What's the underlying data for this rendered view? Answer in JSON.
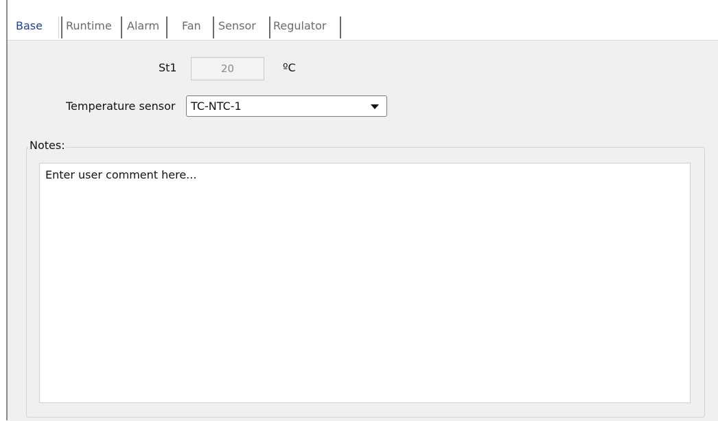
{
  "tabs": [
    {
      "label": "Base",
      "active": true
    },
    {
      "label": "Runtime",
      "active": false
    },
    {
      "label": "Alarm",
      "active": false
    },
    {
      "label": "Fan",
      "active": false
    },
    {
      "label": "Sensor",
      "active": false
    },
    {
      "label": "Regulator",
      "active": false
    }
  ],
  "form": {
    "st1_label": "St1",
    "st1_value": "20",
    "st1_unit": "ºC",
    "temp_sensor_label": "Temperature sensor",
    "temp_sensor_value": "TC-NTC-1"
  },
  "notes": {
    "title": "Notes:",
    "text": "Enter user comment here..."
  },
  "colors": {
    "active_tab": "#1d3f9a",
    "inactive_tab": "#6b6b6b",
    "panel_bg": "#f0f0f0"
  }
}
